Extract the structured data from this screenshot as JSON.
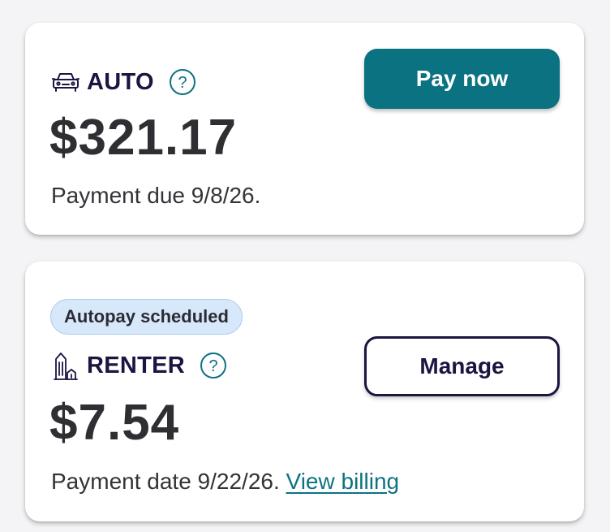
{
  "auto_card": {
    "icon": "car-icon",
    "product": "AUTO",
    "help_icon": "question-circle-icon",
    "amount": "$321.17",
    "due_text": "Payment due 9/8/26.",
    "button_label": "Pay now"
  },
  "renter_card": {
    "badge": "Autopay scheduled",
    "icon": "building-icon",
    "product": "RENTER",
    "help_icon": "question-circle-icon",
    "amount": "$7.54",
    "due_text": "Payment date 9/22/26.",
    "link_text": "View billing",
    "button_label": "Manage"
  },
  "colors": {
    "brand_teal": "#0b7282",
    "navy": "#1a1541",
    "badge_bg": "#d8e8fb",
    "link": "#0d7282"
  }
}
